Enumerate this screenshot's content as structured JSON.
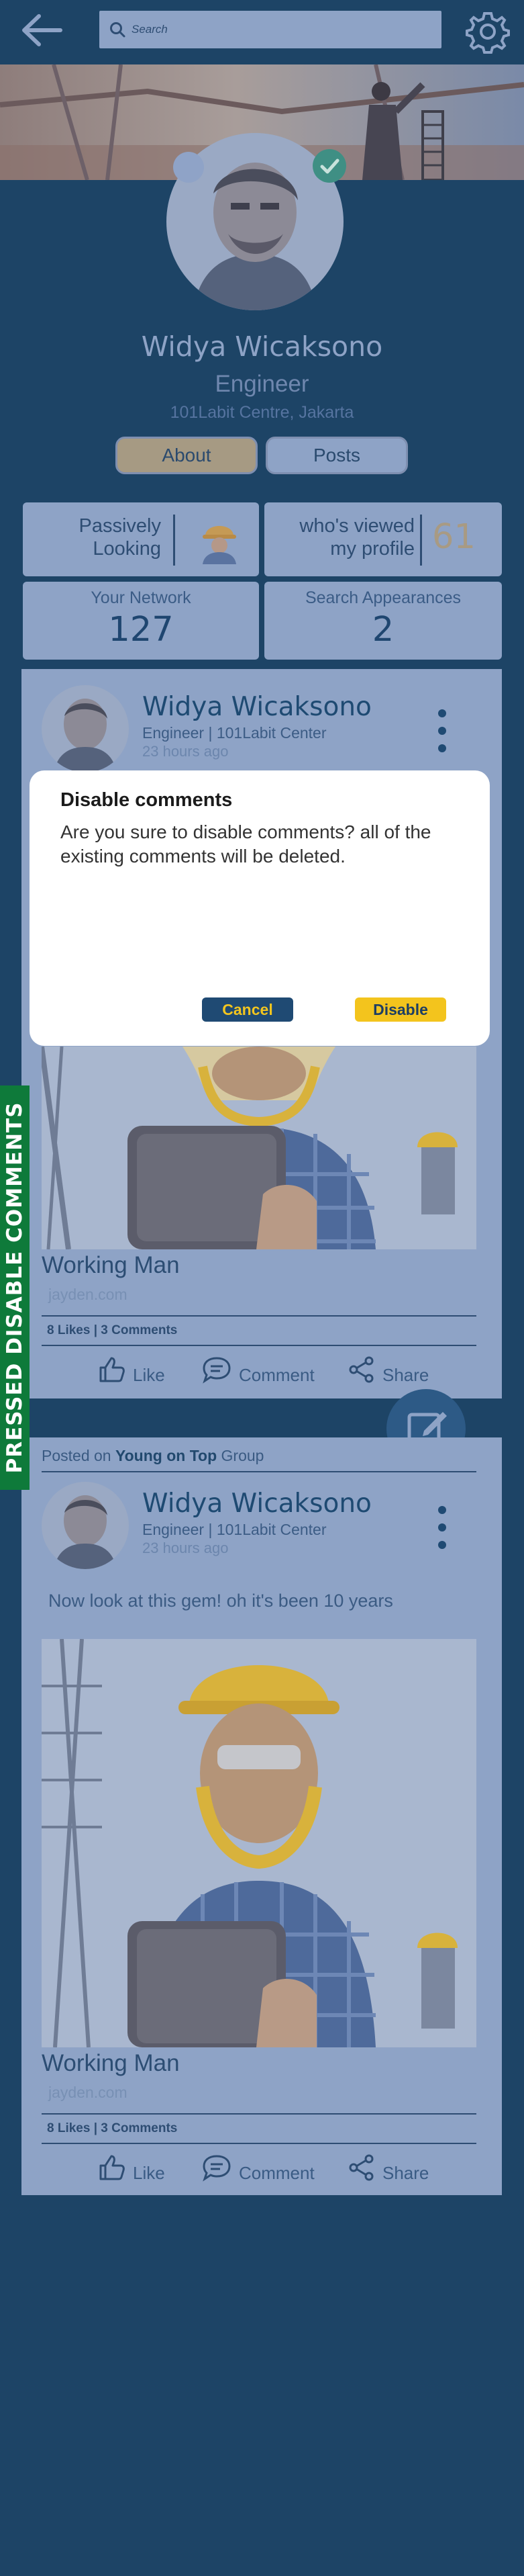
{
  "header": {
    "search_placeholder": "Search"
  },
  "profile": {
    "name": "Widya Wicaksono",
    "title": "Engineer",
    "location": "101Labit Centre, Jakarta",
    "tabs": [
      "About",
      "Posts"
    ]
  },
  "stats": {
    "status_line1": "Passively",
    "status_line2": "Looking",
    "viewed_line1": "who's viewed",
    "viewed_line2": "my profile",
    "viewed_count": "61",
    "network_label": "Your Network",
    "network_count": "127",
    "search_label": "Search Appearances",
    "search_count": "2"
  },
  "post1": {
    "author": "Widya Wicaksono",
    "subtitle": "Engineer | 101Labit Center",
    "time": "23 hours ago",
    "image_title": "Working Man",
    "image_domain": "jayden.com",
    "counts": "8 Likes | 3 Comments",
    "like": "Like",
    "comment": "Comment",
    "share": "Share"
  },
  "post2": {
    "posted_prefix": "Posted on",
    "group_name": "Young on Top",
    "group_suffix": "Group",
    "author": "Widya Wicaksono",
    "subtitle": "Engineer | 101Labit Center",
    "time": "23 hours ago",
    "text": "Now look at this gem! oh it's been 10 years",
    "image_title": "Working Man",
    "image_domain": "jayden.com",
    "counts": "8 Likes | 3 Comments",
    "like": "Like",
    "comment": "Comment",
    "share": "Share"
  },
  "dialog": {
    "title": "Disable comments",
    "message": "Are you sure to disable comments? all of the existing comments will be deleted.",
    "cancel": "Cancel",
    "confirm": "Disable"
  },
  "side_label": "PRESSED DISABLE COMMENTS",
  "icons": [
    "back-arrow-icon",
    "search-icon",
    "gear-icon",
    "check-icon",
    "worker-icon",
    "kebab-icon",
    "thumbs-up-icon",
    "comment-icon",
    "share-icon",
    "edit-icon"
  ],
  "colors": {
    "background": "#1d4466",
    "card": "#8ea3c6",
    "accent_yellow": "#f3c41d",
    "label_green": "#0e7a3a"
  }
}
